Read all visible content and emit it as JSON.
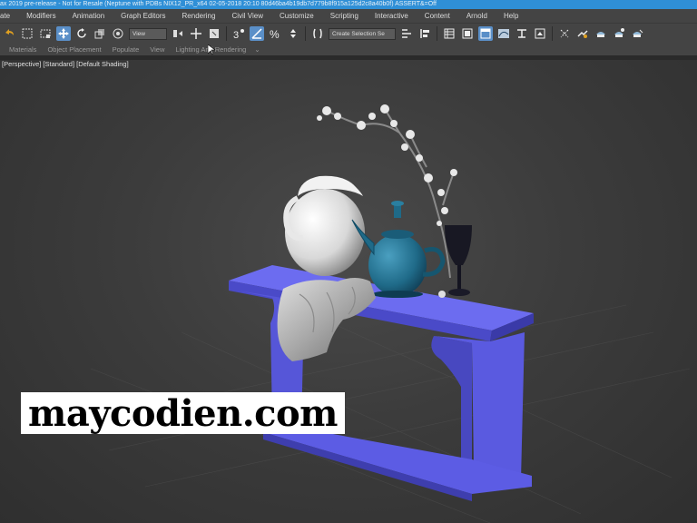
{
  "window": {
    "title": "ax 2019 pre-release - Not for Resale (Neptune with PDBs NIX12_PR_x64 02-05-2018 20:10 80d46ba4b19db7d779b8f915a125d2c8a40b0f) ASSERT&=Off"
  },
  "menu": {
    "items": [
      {
        "label": "ate"
      },
      {
        "label": "Modifiers"
      },
      {
        "label": "Animation"
      },
      {
        "label": "Graph Editors"
      },
      {
        "label": "Rendering"
      },
      {
        "label": "Civil View"
      },
      {
        "label": "Customize"
      },
      {
        "label": "Scripting"
      },
      {
        "label": "Interactive"
      },
      {
        "label": "Content"
      },
      {
        "label": "Arnold"
      },
      {
        "label": "Help"
      }
    ]
  },
  "toolbar": {
    "view_dropdown": "View",
    "selection_set_dropdown": "Create Selection Se",
    "icons": [
      "select-object-icon",
      "region-select-icon",
      "window-crossing-icon",
      "move-icon",
      "rotate-icon",
      "scale-icon",
      "select-filter-icon",
      "snap-icon",
      "percent-snap-icon",
      "spinner-snap-icon",
      "mirror-icon",
      "align-icon",
      "layer-icon",
      "scene-explorer-icon",
      "schematic-icon",
      "material-editor-icon",
      "render-setup-icon",
      "render-frame-icon",
      "render-icon",
      "teapot-render-icon"
    ]
  },
  "ribbon": {
    "tabs": [
      {
        "label": "Materials"
      },
      {
        "label": "Object Placement"
      },
      {
        "label": "Populate"
      },
      {
        "label": "View"
      },
      {
        "label": "Lighting And Rendering"
      }
    ]
  },
  "viewport": {
    "label": "[Perspective] [Standard] [Default Shading]",
    "table_color": "#5c5ce0",
    "background": "#3a3a3a"
  },
  "watermark": {
    "text": "maycodien.com"
  },
  "colors": {
    "title_bar": "#2f8fd6",
    "ui_panel": "#444444",
    "active_tool": "#5a8fc8",
    "teapot": "#1f6a88"
  }
}
